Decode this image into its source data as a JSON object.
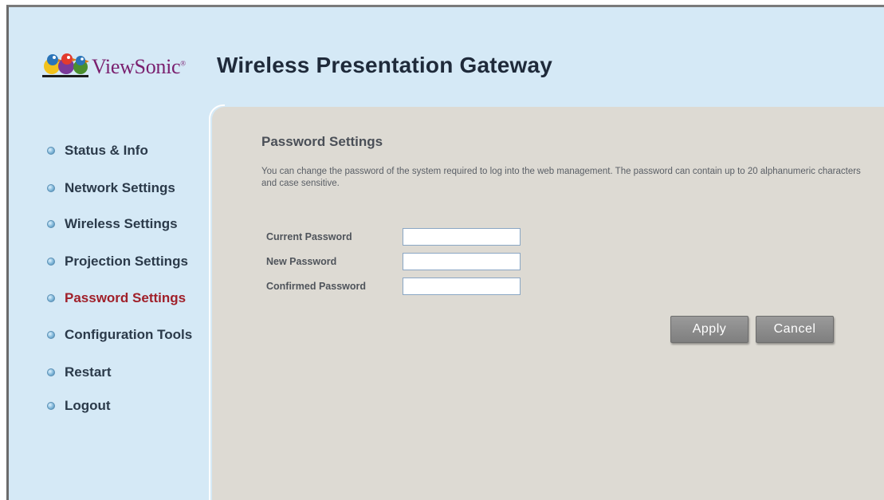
{
  "brand": {
    "logo_text": "ViewSonic",
    "logo_mark": "®",
    "product_title": "Wireless Presentation Gateway",
    "logo_color": "#7a1f6e"
  },
  "sidebar": {
    "items": [
      {
        "label": "Status & Info",
        "icon": "bullet-icon"
      },
      {
        "label": "Network Settings",
        "icon": "bullet-icon"
      },
      {
        "label": "Wireless Settings",
        "icon": "bullet-icon"
      },
      {
        "label": "Projection Settings",
        "icon": "bullet-icon"
      },
      {
        "label": "Password Settings",
        "icon": "bullet-icon",
        "active": true
      },
      {
        "label": "Configuration Tools",
        "icon": "bullet-icon"
      },
      {
        "label": "Restart",
        "icon": "bullet-icon"
      },
      {
        "label": "Logout",
        "icon": "bullet-icon"
      }
    ],
    "active_color": "#a0202a"
  },
  "main": {
    "title": "Password Settings",
    "description": "You can change the password of the system required to log into the web management. The password can contain up to 20 alphanumeric characters and case sensitive.",
    "fields": [
      {
        "label": "Current Password",
        "value": ""
      },
      {
        "label": "New Password",
        "value": ""
      },
      {
        "label": "Confirmed Password",
        "value": ""
      }
    ],
    "apply_label": "Apply",
    "cancel_label": "Cancel"
  }
}
